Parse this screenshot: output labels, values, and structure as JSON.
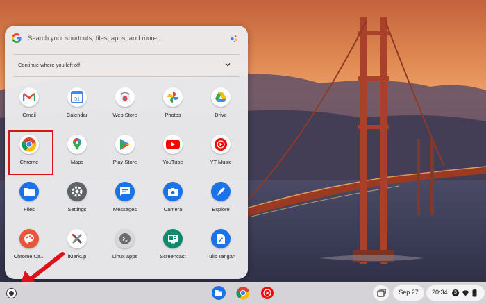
{
  "search": {
    "placeholder": "Search your shortcuts, files, apps, and more..."
  },
  "continue": {
    "label": "Continue where you left off"
  },
  "apps": [
    {
      "label": "Gmail",
      "icon": "gmail-icon"
    },
    {
      "label": "Calendar",
      "icon": "calendar-icon",
      "day": "31"
    },
    {
      "label": "Web Store",
      "icon": "web-store-icon"
    },
    {
      "label": "Photos",
      "icon": "photos-icon"
    },
    {
      "label": "Drive",
      "icon": "drive-icon"
    },
    {
      "label": "Chrome",
      "icon": "chrome-icon",
      "highlighted": true
    },
    {
      "label": "Maps",
      "icon": "maps-icon"
    },
    {
      "label": "Play Store",
      "icon": "play-store-icon"
    },
    {
      "label": "YouTube",
      "icon": "youtube-icon"
    },
    {
      "label": "YT Music",
      "icon": "yt-music-icon"
    },
    {
      "label": "Files",
      "icon": "files-icon"
    },
    {
      "label": "Settings",
      "icon": "settings-icon"
    },
    {
      "label": "Messages",
      "icon": "messages-icon"
    },
    {
      "label": "Camera",
      "icon": "camera-icon"
    },
    {
      "label": "Explore",
      "icon": "explore-icon"
    },
    {
      "label": "Chrome Ca...",
      "icon": "chrome-canvas-icon"
    },
    {
      "label": "iMarkup",
      "icon": "imarkup-icon"
    },
    {
      "label": "Linux apps",
      "icon": "linux-apps-icon"
    },
    {
      "label": "Screencast",
      "icon": "screencast-icon"
    },
    {
      "label": "Tulis Tangan",
      "icon": "tulis-tangan-icon"
    }
  ],
  "shelf": {
    "pinned": [
      "files-icon",
      "chrome-icon",
      "yt-music-icon"
    ],
    "date": "Sep 27",
    "time": "20:34",
    "notification_count": "3"
  },
  "colors": {
    "highlight": "#e0101a",
    "arrow": "#e0101a",
    "accent": "#1a73e8"
  }
}
